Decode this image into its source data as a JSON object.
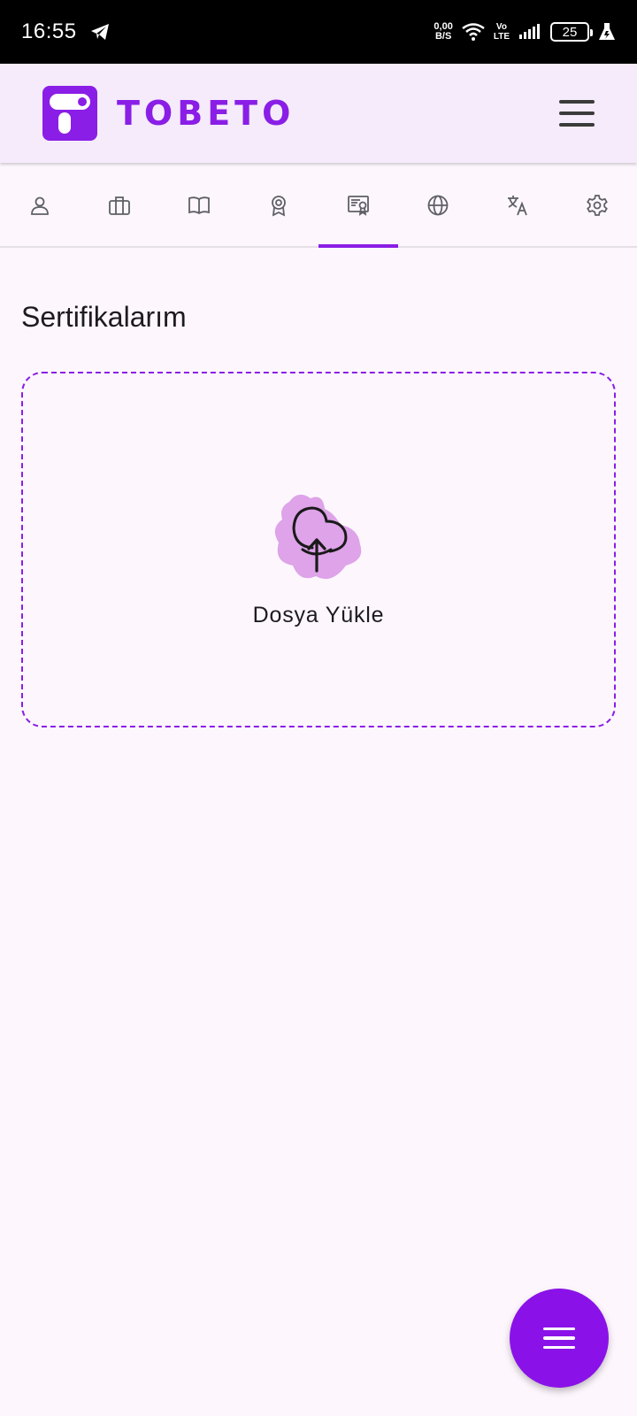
{
  "status_bar": {
    "time": "16:55",
    "net_speed_value": "0,00",
    "net_speed_unit": "B/S",
    "volte_top": "Vo",
    "volte_bottom": "LTE",
    "battery": "25"
  },
  "app_bar": {
    "brand": "TOBETO",
    "brand_color": "#8a1ee6",
    "menu_icon": "hamburger-icon"
  },
  "tabs": [
    {
      "icon": "person-icon",
      "active": false
    },
    {
      "icon": "briefcase-icon",
      "active": false
    },
    {
      "icon": "book-icon",
      "active": false
    },
    {
      "icon": "award-icon",
      "active": false
    },
    {
      "icon": "certificate-icon",
      "active": true
    },
    {
      "icon": "globe-icon",
      "active": false
    },
    {
      "icon": "translate-icon",
      "active": false
    },
    {
      "icon": "settings-icon",
      "active": false
    }
  ],
  "main": {
    "title": "Sertifikalarım",
    "upload_label": "Dosya Yükle",
    "upload_icon": "cloud-upload-icon"
  },
  "fab": {
    "icon": "menu-icon",
    "color": "#8a12e8"
  }
}
